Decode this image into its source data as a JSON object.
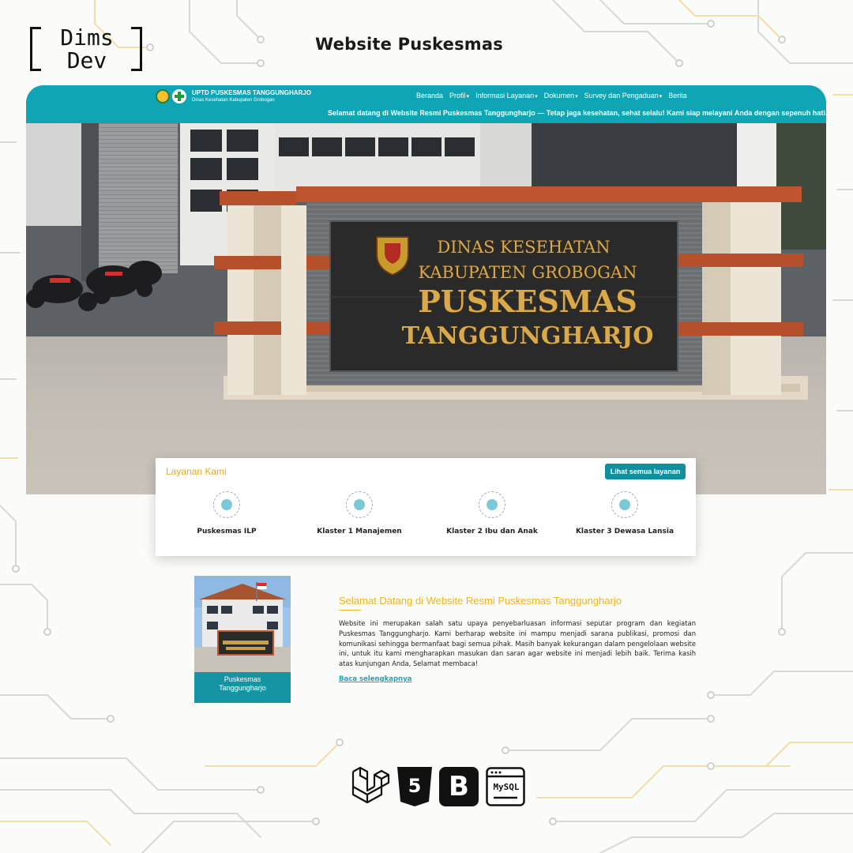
{
  "brand": {
    "line1": "Dims",
    "line2": "Dev"
  },
  "page_title": "Website Puskesmas",
  "site": {
    "logo_title": "UPTD PUSKESMAS TANGGUNGHARJO",
    "logo_subtitle": "Dinas Kesehatan Kabupaten Grobogan",
    "nav": [
      {
        "label": "Beranda",
        "dropdown": false
      },
      {
        "label": "Profil",
        "dropdown": true
      },
      {
        "label": "Informasi Layanan",
        "dropdown": true
      },
      {
        "label": "Dokumen",
        "dropdown": true
      },
      {
        "label": "Survey dan Pengaduan",
        "dropdown": true
      },
      {
        "label": "Berita",
        "dropdown": false
      }
    ],
    "marquee": "Selamat datang di Website Resmi Puskesmas Tanggungharjo — Tetap jaga kesehatan, sehat selalu! Kami siap melayani Anda dengan sepenuh hati."
  },
  "hero": {
    "sign_line1": "DINAS KESEHATAN",
    "sign_line2": "KABUPATEN GROBOGAN",
    "sign_line3": "PUSKESMAS",
    "sign_line4": "TANGGUNGHARJO"
  },
  "services": {
    "title": "Layanan Kami",
    "button": "Lihat semua layanan",
    "items": [
      {
        "label": "Puskesmas ILP",
        "icon": "people-network-icon"
      },
      {
        "label": "Klaster 1 Manajemen",
        "icon": "management-icon"
      },
      {
        "label": "Klaster 2 Ibu dan Anak",
        "icon": "mother-child-icon"
      },
      {
        "label": "Klaster 3 Dewasa Lansia",
        "icon": "elderly-icon"
      }
    ]
  },
  "welcome": {
    "photo_caption_line1": "Puskesmas",
    "photo_caption_line2": "Tanggungharjo",
    "title": "Selamat Datang di Website Resmi Puskesmas Tanggungharjo",
    "body": "Website ini merupakan salah satu upaya penyebarluasan informasi seputar program dan kegiatan Puskesmas Tanggungharjo. Kami berharap website ini mampu menjadi sarana publikasi, promosi dan komunikasi sehingga bermanfaat bagi semua pihak. Masih banyak kekurangan dalam pengelolaan website ini, untuk itu kami mengharapkan masukan dan saran agar website ini menjadi lebih baik. Terima kasih atas kunjungan Anda, Selamat membaca!",
    "link": "Baca selengkapnya"
  },
  "tech": {
    "html5_label": "5",
    "bootstrap_label": "B",
    "mysql_label": "MySQL",
    "icons": [
      "laravel-icon",
      "html5-icon",
      "bootstrap-icon",
      "mysql-icon"
    ]
  },
  "colors": {
    "navbar": "#0fa5b5",
    "accent": "#f0a91b",
    "button": "#128e9f"
  }
}
